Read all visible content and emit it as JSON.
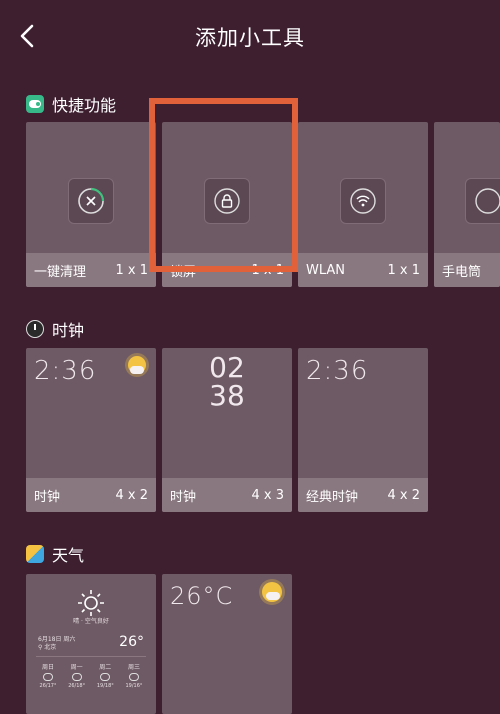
{
  "header": {
    "title": "添加小工具",
    "back_icon": "chevron-left-icon"
  },
  "sections": {
    "quick": {
      "title": "快捷功能",
      "icon": "toggle-icon",
      "cards": [
        {
          "name": "一键清理",
          "size": "1 x 1",
          "icon": "clean-icon"
        },
        {
          "name": "锁屏",
          "size": "1 x 1",
          "icon": "lock-icon",
          "highlighted": true
        },
        {
          "name": "WLAN",
          "size": "1 x 1",
          "icon": "wifi-icon"
        },
        {
          "name": "手电筒",
          "size": "",
          "icon": "flashlight-icon"
        }
      ]
    },
    "clock": {
      "title": "时钟",
      "icon": "clock-icon",
      "cards": [
        {
          "name": "时钟",
          "size": "4 x 2",
          "time": "2:36"
        },
        {
          "name": "时钟",
          "size": "4 x 3",
          "hour": "02",
          "minute": "38"
        },
        {
          "name": "经典时钟",
          "size": "4 x 2",
          "time": "2:36"
        }
      ]
    },
    "weather": {
      "title": "天气",
      "icon": "weather-icon",
      "card1": {
        "condition": "晴 · 空气良好",
        "date": "6月18日 周六",
        "place": "⚲ 北京",
        "temp": "26°",
        "days": [
          {
            "label": "周日",
            "hilo": "26/17°"
          },
          {
            "label": "周一",
            "hilo": "26/18°"
          },
          {
            "label": "周二",
            "hilo": "19/18°"
          },
          {
            "label": "周三",
            "hilo": "19/16°"
          }
        ]
      },
      "card2": {
        "temp": "26°C"
      }
    }
  },
  "colors": {
    "background": "#3e1f30",
    "card": "#6e5a64",
    "footer": "#8a7880",
    "highlight": "#e1613a"
  }
}
